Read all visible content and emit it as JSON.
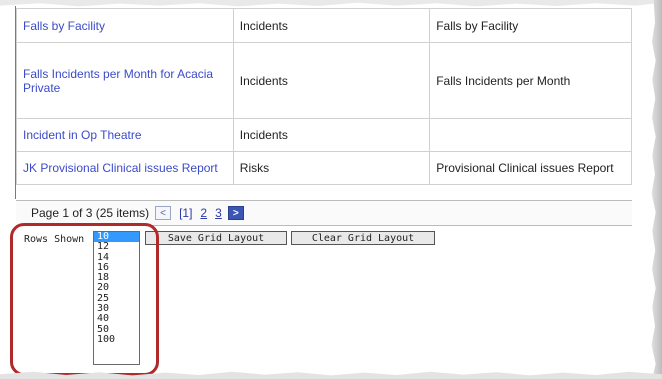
{
  "grid": {
    "rows": [
      {
        "name": "Falls by Facility",
        "type": "Incidents",
        "report": "Falls by Facility"
      },
      {
        "name": "Falls Incidents per Month for Acacia Private",
        "type": "Incidents",
        "report": "Falls Incidents per Month"
      },
      {
        "name": "Incident in Op Theatre",
        "type": "Incidents",
        "report": ""
      },
      {
        "name": "JK Provisional Clinical issues Report",
        "type": "Risks",
        "report": "Provisional Clinical issues Report"
      }
    ]
  },
  "pager": {
    "summary": "Page 1 of 3 (25 items)",
    "prev": "<",
    "current": "[1]",
    "page2": "2",
    "page3": "3",
    "next": ">"
  },
  "rows_shown": {
    "label": "Rows Shown",
    "options": [
      "10",
      "12",
      "14",
      "16",
      "18",
      "20",
      "25",
      "30",
      "40",
      "50",
      "100"
    ],
    "selected": "10"
  },
  "buttons": {
    "save": "Save Grid Layout",
    "clear": "Clear Grid Layout"
  },
  "colors": {
    "link": "#3b4bc8",
    "selection": "#3399ff",
    "highlight": "#b02a2a"
  }
}
